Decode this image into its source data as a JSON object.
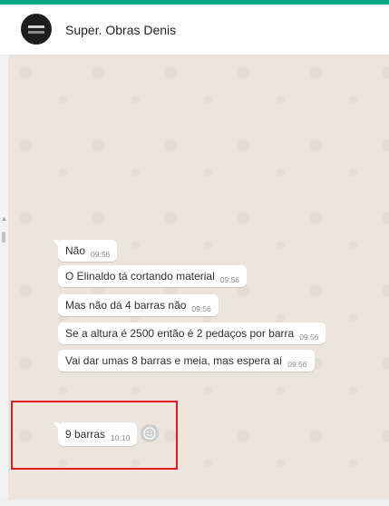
{
  "colors": {
    "accent": "#00a884",
    "highlight_border": "#e11d1d",
    "chat_background": "#ece5dd",
    "bubble": "#ffffff"
  },
  "header": {
    "contact_name": "Super. Obras Denis",
    "avatar_icon": "business-logo-avatar"
  },
  "messages": [
    {
      "text": "Não",
      "time": "09:56"
    },
    {
      "text": "O Elinaldo tá cortando material",
      "time": "09:56"
    },
    {
      "text": "Mas não dá 4 barras não",
      "time": "09:56"
    },
    {
      "text": "Se a altura é 2500 então é 2 pedaços por barra",
      "time": "09:56"
    },
    {
      "text": "Vai dar umas 8 barras e meia, mas espera aí",
      "time": "09:56"
    },
    {
      "text": "9 barras",
      "time": "10:10"
    }
  ],
  "icons": {
    "emoji_reaction": "smiley-face-icon"
  }
}
